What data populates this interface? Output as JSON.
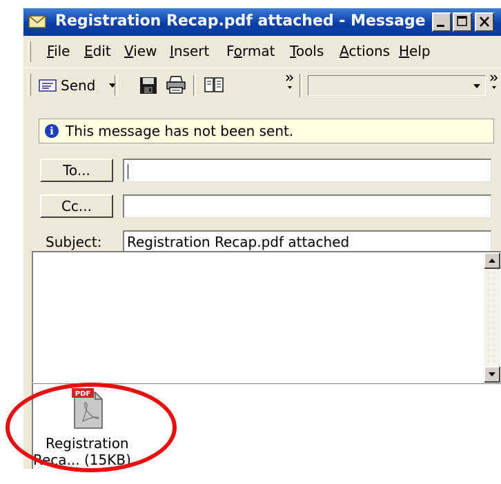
{
  "window": {
    "title": "Registration Recap.pdf attached - Message (P...",
    "title_icon": "envelope-icon",
    "controls": [
      "minimize-icon",
      "maximize-icon",
      "close-icon"
    ]
  },
  "menu": {
    "items": [
      {
        "label": "File",
        "accel": "F"
      },
      {
        "label": "Edit",
        "accel": "E"
      },
      {
        "label": "View",
        "accel": "V"
      },
      {
        "label": "Insert",
        "accel": "I"
      },
      {
        "label": "Format",
        "accel": "o"
      },
      {
        "label": "Tools",
        "accel": "T"
      },
      {
        "label": "Actions",
        "accel": "A"
      },
      {
        "label": "Help",
        "accel": "H"
      }
    ]
  },
  "toolbar": {
    "send_label": "Send",
    "icons": [
      "send-icon",
      "save-icon",
      "print-icon",
      "address-book-icon"
    ],
    "combo_value": ""
  },
  "infobar": {
    "text": "This message has not been sent."
  },
  "fields": {
    "to_button": "To...",
    "cc_button": "Cc...",
    "to_value": "",
    "cc_value": "",
    "subject_label": "Subject:",
    "subject_value": "Registration Recap.pdf attached"
  },
  "attachment": {
    "icon": "pdf-file-icon",
    "badge": "PDF",
    "name_line1": "Registration",
    "name_line2": "Reca... (15KB)"
  },
  "colors": {
    "titlebar": "#0a3fa8",
    "window_bg": "#ece9d8",
    "infobar_bg": "#ffffe1",
    "highlight_ring": "#e80f0f"
  }
}
